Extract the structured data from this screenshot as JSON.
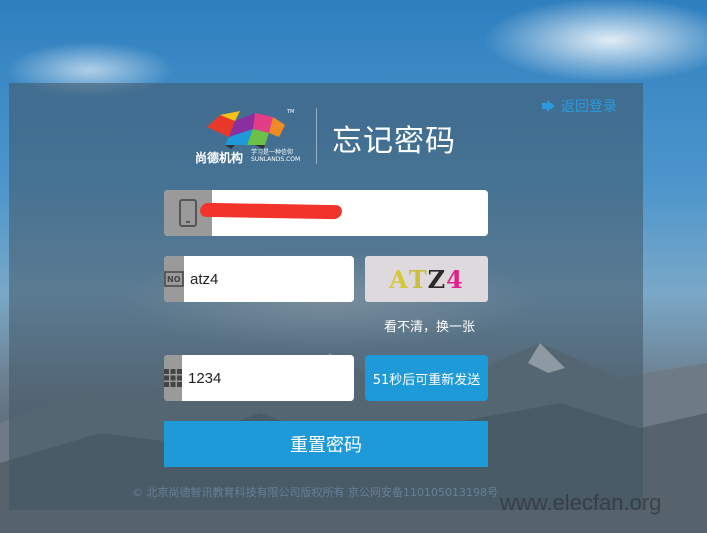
{
  "header": {
    "back_link": "返回登录",
    "title": "忘记密码",
    "logo_name": "尚德机构",
    "logo_slogan_1": "学习是一种信仰",
    "logo_slogan_2": "SUNLANDS.COM"
  },
  "form": {
    "phone_value": "",
    "captcha_input_value": "atz4",
    "captcha_image_text": [
      "A",
      "T",
      "Z",
      "4"
    ],
    "refresh_captcha": "看不清，换一张",
    "sms_code_value": "1234",
    "sms_button": "51秒后可重新发送",
    "submit_button": "重置密码"
  },
  "footer": {
    "copyright": "© 北京尚德智讯教育科技有限公司版权所有 京公网安备110105013198号",
    "watermark": "www.elecfan.org"
  }
}
